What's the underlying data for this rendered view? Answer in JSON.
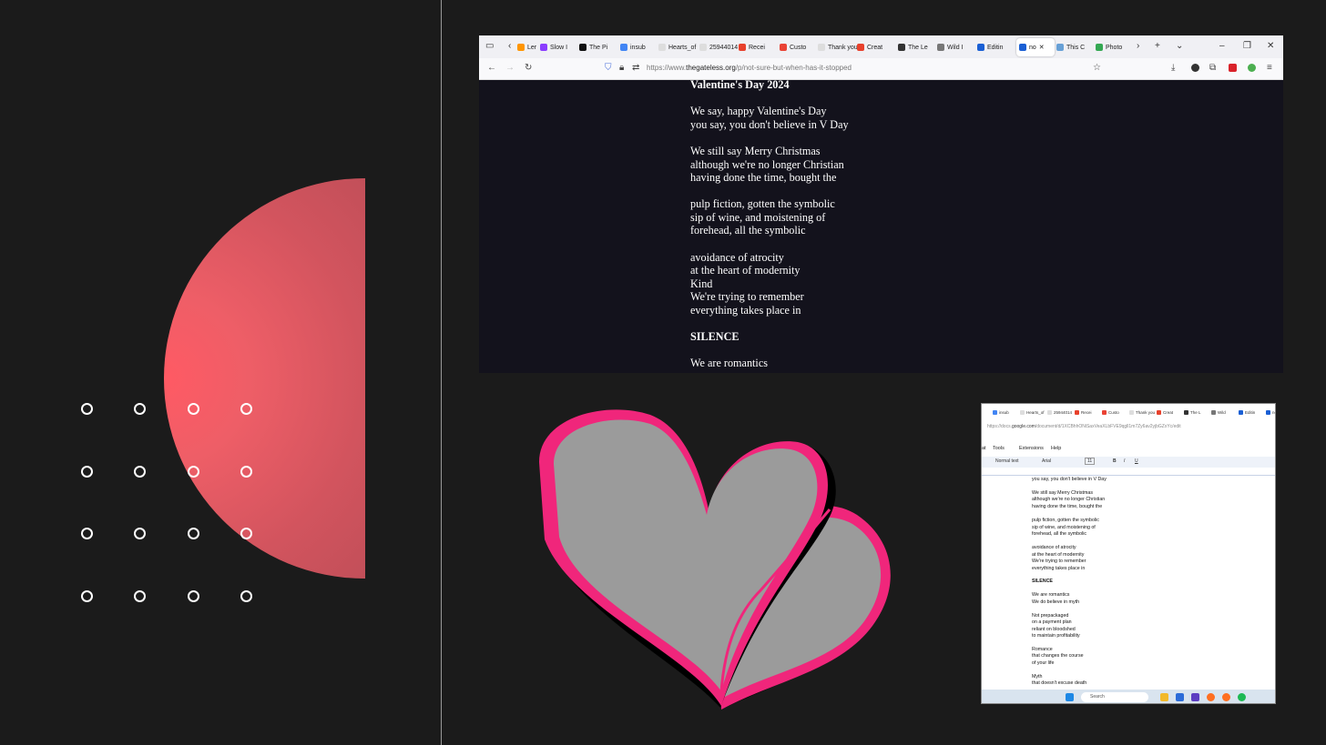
{
  "browser": {
    "tabs": [
      {
        "label": "Ler",
        "color": "#ff9500"
      },
      {
        "label": "Slow I",
        "color": "#8b3dff"
      },
      {
        "label": "The Pi",
        "color": "#111111"
      },
      {
        "label": "insub",
        "color": "#4285f4"
      },
      {
        "label": "Hearts_of",
        "color": "#dddddd"
      },
      {
        "label": "25944014",
        "color": "#dddddd"
      },
      {
        "label": "Recei",
        "color": "#e8412c"
      },
      {
        "label": "Custo",
        "color": "#ea4335"
      },
      {
        "label": "Thank you",
        "color": "#dddddd"
      },
      {
        "label": "Creat",
        "color": "#e8412c"
      },
      {
        "label": "The Le",
        "color": "#333333"
      },
      {
        "label": "Wild I",
        "color": "#777777"
      },
      {
        "label": "Editin",
        "color": "#1a5fd4"
      },
      {
        "label": "no",
        "color": "#1a5fd4"
      },
      {
        "label": "This C",
        "color": "#67a0d6"
      },
      {
        "label": "Photo",
        "color": "#34a853"
      }
    ],
    "url_prefix": "https://www.",
    "url_domain": "thegateless.org",
    "url_path": "/p/not-sure-but-when-has-it-stopped"
  },
  "poem": {
    "lines": [
      {
        "text": "Valentine's Day 2024",
        "bold": true
      },
      {
        "text": "We say, happy Valentine's Day"
      },
      {
        "text": "you say, you don't believe in V Day"
      },
      {
        "text": "We still say Merry Christmas"
      },
      {
        "text": "although we're no longer Christian"
      },
      {
        "text": "having done the time, bought the"
      },
      {
        "text": "pulp fiction, gotten the symbolic"
      },
      {
        "text": "sip of wine, and moistening of"
      },
      {
        "text": "forehead, all the symbolic"
      },
      {
        "text": "avoidance of atrocity"
      },
      {
        "text": "at the heart of modernity"
      },
      {
        "text": " Kind"
      },
      {
        "text": "We're trying to remember"
      },
      {
        "text": "everything takes place in"
      },
      {
        "text": "SILENCE",
        "bold": true
      },
      {
        "text": "We are romantics"
      }
    ]
  },
  "docs": {
    "tabs": [
      "insub",
      "Hearts_of",
      "25944014",
      "Recei",
      "Custo",
      "Thank you",
      "Creat",
      "The L",
      "Wild",
      "Editin",
      "no"
    ],
    "url_prefix": "https://docs.",
    "url_domain": "google.com",
    "url_path": "/document/d/1XCBhhONiSaxVeaXLbFVE9qgll1m7Zy6av2yjbGZxYc/edit",
    "menu": [
      "at",
      "Tools",
      "Extensions",
      "Help"
    ],
    "toolbar": {
      "style": "Normal text",
      "font": "Arial",
      "size": "11"
    },
    "lines": [
      {
        "text": "you say, you don't believe in V Day"
      },
      {
        "text": "We still say Merry Christmas"
      },
      {
        "text": "although we're no longer Christian"
      },
      {
        "text": "having done the time, bought the"
      },
      {
        "text": "pulp fiction, gotten the symbolic"
      },
      {
        "text": "sip of wine, and moistening of"
      },
      {
        "text": "forehead, all the symbolic"
      },
      {
        "text": "avoidance of atrocity"
      },
      {
        "text": "at the heart of modernity"
      },
      {
        "text": "We're trying to remember"
      },
      {
        "text": "everything takes place in"
      },
      {
        "text": "SILENCE",
        "bold": true
      },
      {
        "text": "We are romantics"
      },
      {
        "text": "We do believe in myth"
      },
      {
        "text": "Not prepackaged"
      },
      {
        "text": "on a payment plan"
      },
      {
        "text": "reliant on bloodshed"
      },
      {
        "text": "to maintain profitability"
      },
      {
        "text": "Romance"
      },
      {
        "text": "that changes the course"
      },
      {
        "text": "of your life"
      },
      {
        "text": "Myth"
      },
      {
        "text": "that doesn't excuse death"
      }
    ],
    "taskbar_search": "Search"
  },
  "colors": {
    "background": "#1b1b1b",
    "heart_fill": "#9b9b9b",
    "heart_outline": "#f0267b",
    "disc": "#e0555f"
  }
}
